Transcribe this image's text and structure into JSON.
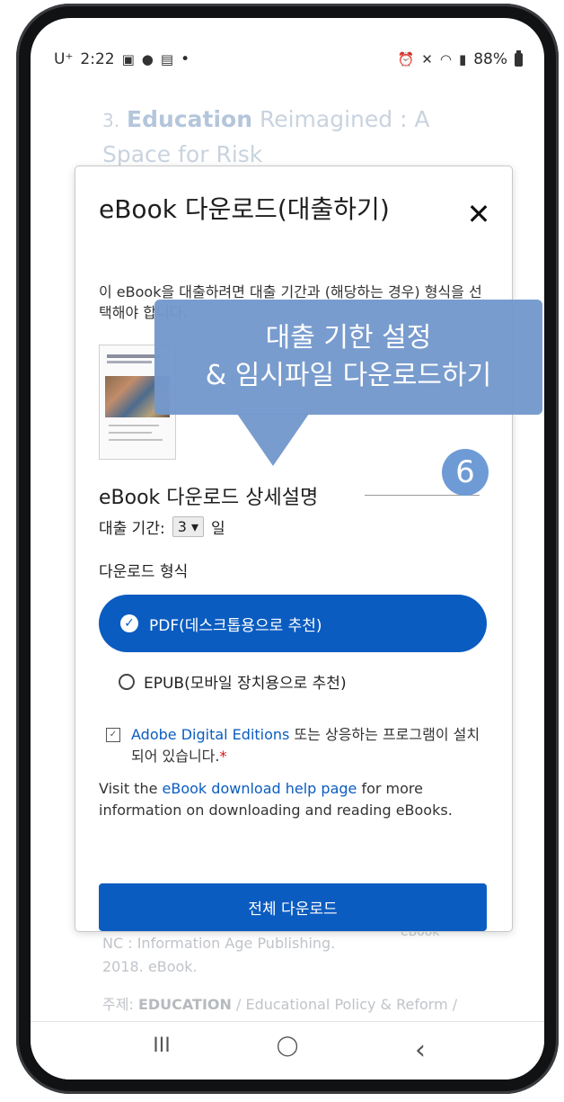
{
  "status_bar": {
    "carrier": "U⁺",
    "time": "2:22",
    "left_icons": [
      "gallery-icon",
      "talk-icon",
      "message-icon"
    ],
    "dot": "•",
    "right_icons": [
      "alarm-icon",
      "mute-icon",
      "wifi-icon",
      "signal-icon"
    ],
    "battery": "88%"
  },
  "background_page": {
    "item_number": "3.",
    "item_title_bold": "Education",
    "item_title_rest": " Reimagined : A Space for Risk",
    "publisher": "NC : Information Age Publishing. 2018. eBook.",
    "format_badge": "eBook",
    "subject_label": "주제:",
    "subject_bold": "EDUCATION",
    "subject_rest": " / Educational Policy & Reform / General; EDUCATION /"
  },
  "dialog": {
    "title": "eBook 다운로드(대출하기)",
    "close_label": "✕",
    "description": "이 eBook을 대출하려면 대출 기간과 (해당하는 경우) 형식을 선택해야 합니다.",
    "subtitle": "eBook 다운로드 상세설명",
    "period_label": "대출 기간:",
    "period_value": "3 ▾",
    "period_unit": "일",
    "format_label": "다운로드 형식",
    "option_pdf": "PDF(데스크톱용으로 추천)",
    "option_epub": "EPUB(모바일 장치용으로 추천)",
    "ade_link": "Adobe Digital Editions",
    "ade_text": " 또는 상응하는 프로그램이 설치되어 있습니다.",
    "required_mark": "*",
    "visit_prefix": "Visit the ",
    "visit_link": "eBook download help page",
    "visit_suffix": " for more information on downloading and reading eBooks.",
    "download_button": "전체 다운로드"
  },
  "callout": {
    "line1": "대출 기한 설정",
    "line2": "& 임시파일 다운로드하기",
    "step": "6"
  },
  "nav": {
    "recent": "III",
    "home": "◯",
    "back": "‹"
  }
}
